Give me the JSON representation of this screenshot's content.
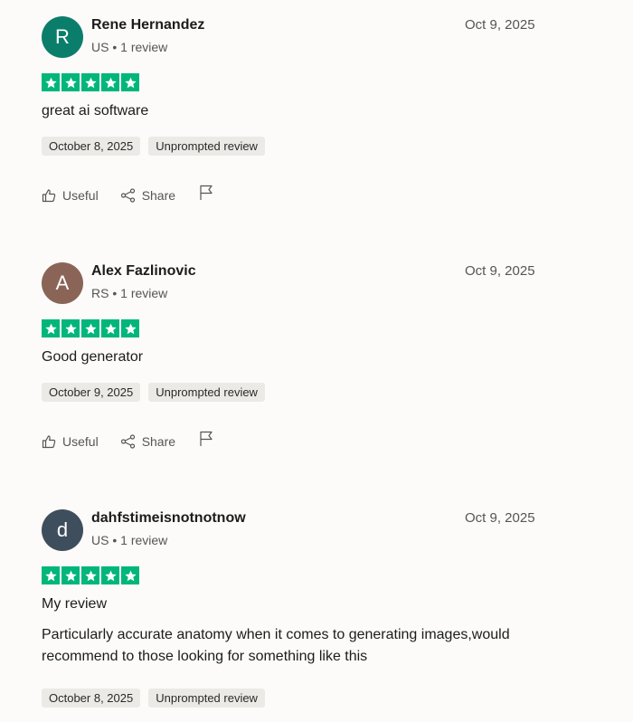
{
  "reviews": [
    {
      "initial": "R",
      "avatar_color": "#0b7e6b",
      "name": "Rene Hernandez",
      "country": "US",
      "review_count": "1 review",
      "date": "Oct 9, 2025",
      "rating": 5,
      "title": "great ai software",
      "body": "",
      "experience_date": "October 8, 2025",
      "tag": "Unprompted review",
      "useful_label": "Useful",
      "share_label": "Share"
    },
    {
      "initial": "A",
      "avatar_color": "#8a6557",
      "name": "Alex Fazlinovic",
      "country": "RS",
      "review_count": "1 review",
      "date": "Oct 9, 2025",
      "rating": 5,
      "title": "Good generator",
      "body": "",
      "experience_date": "October 9, 2025",
      "tag": "Unprompted review",
      "useful_label": "Useful",
      "share_label": "Share"
    },
    {
      "initial": "d",
      "avatar_color": "#3f4e5c",
      "name": "dahfstimeisnotnotnow",
      "country": "US",
      "review_count": "1 review",
      "date": "Oct 9, 2025",
      "rating": 5,
      "title": "My review",
      "body": "Particularly accurate anatomy when it comes to generating images,would recommend to those looking for something like this",
      "experience_date": "October 8, 2025",
      "tag": "Unprompted review",
      "useful_label": "Useful",
      "share_label": "Share"
    }
  ],
  "separator": " • ",
  "colors": {
    "star_green": "#00b67a",
    "chip_bg": "#ebeae6",
    "page_bg": "#fcfbf9"
  }
}
